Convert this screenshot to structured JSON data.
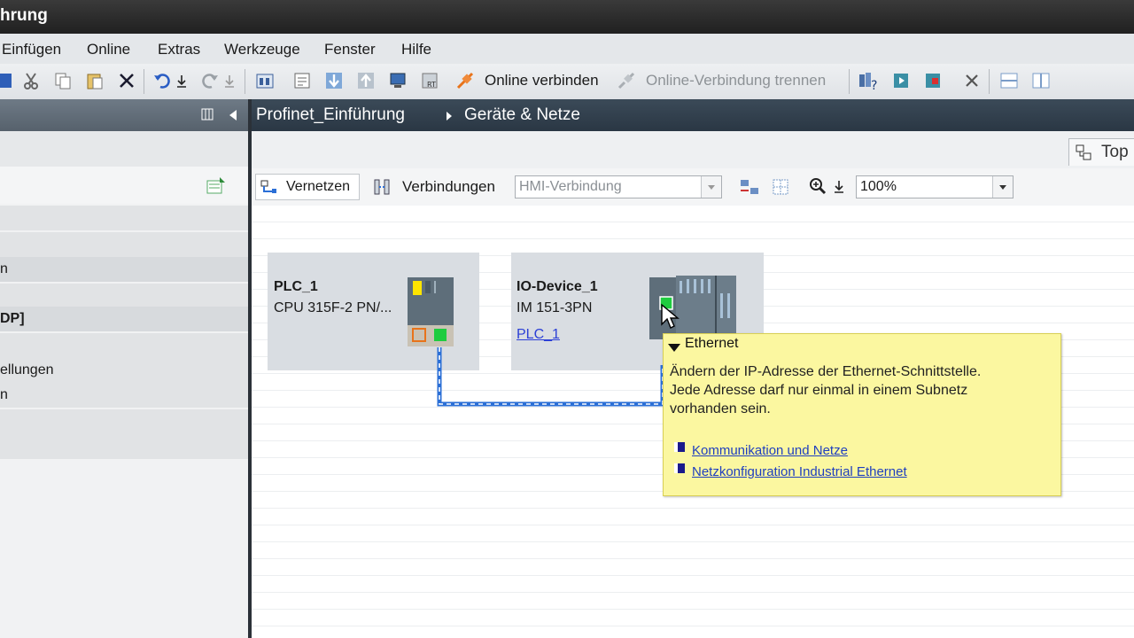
{
  "window": {
    "title": "hrung"
  },
  "menu": [
    "Einfügen",
    "Online",
    "Extras",
    "Werkzeuge",
    "Fenster",
    "Hilfe"
  ],
  "toolbar": {
    "online_connect": "Online verbinden",
    "online_disconnect": "Online-Verbindung trennen"
  },
  "left_panel": {
    "rows": [
      "n",
      "DP]",
      "ellungen",
      "n"
    ]
  },
  "breadcrumb": {
    "project": "Profinet_Einführung",
    "page": "Geräte & Netze"
  },
  "view_tab": {
    "label": "Top"
  },
  "editor_toolbar": {
    "network_button": "Vernetzen",
    "connections_label": "Verbindungen",
    "connection_type": "HMI-Verbindung",
    "zoom": "100%"
  },
  "devices": [
    {
      "name": "PLC_1",
      "type": "CPU 315F-2 PN/..."
    },
    {
      "name": "IO-Device_1",
      "type": "IM 151-3PN",
      "controller_link": "PLC_1"
    }
  ],
  "tooltip": {
    "heading": "Ethernet",
    "line1": "Ändern der IP-Adresse der Ethernet-Schnittstelle.",
    "line2": "Jede Adresse darf nur einmal in einem Subnetz",
    "line3": "vorhanden sein.",
    "links": [
      "Kommunikation und Netze",
      "Netzkonfiguration Industrial Ethernet"
    ]
  },
  "colors": {
    "accent_orange": "#e8731a",
    "network_line": "#2b6fd6",
    "tooltip_bg": "#fbf7a0",
    "breadcrumb_bg": "#2f3d4a"
  }
}
